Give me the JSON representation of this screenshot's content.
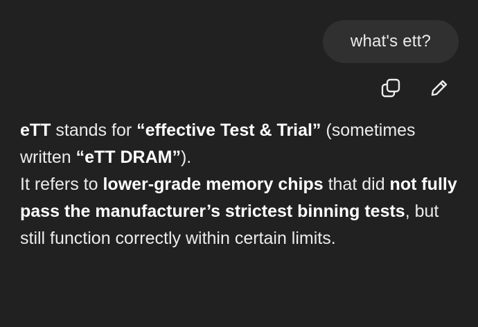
{
  "user_message": {
    "text": "what's ett?"
  },
  "message_actions": {
    "copy_icon": "copy-icon",
    "edit_icon": "pencil-icon"
  },
  "answer": {
    "p1": {
      "b1": "eTT",
      "t1": " stands for ",
      "b2": "“effective Test & Trial”",
      "t2": " (sometimes written ",
      "b3": "“eTT DRAM”",
      "t3": ")."
    },
    "p2": {
      "t1": "It refers to ",
      "b1": "lower-grade memory chips",
      "t2": " that did ",
      "b2": "not fully pass the manufacturer’s strictest binning tests",
      "t3": ", but still function correctly within certain limits."
    }
  },
  "colors": {
    "background": "#212121",
    "user_bubble": "#303030",
    "text": "#ececec"
  }
}
